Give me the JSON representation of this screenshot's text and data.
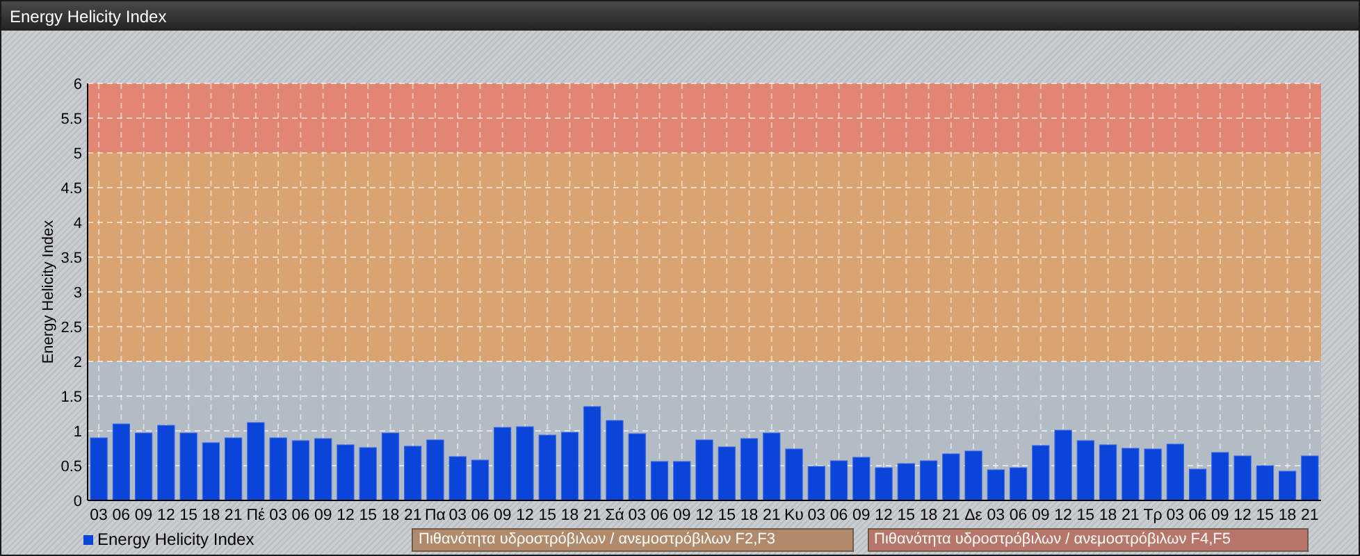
{
  "window": {
    "title": "Energy Helicity Index"
  },
  "chart": {
    "chart_data": {
      "type": "bar",
      "ylabel": "Energy Helicity Index",
      "categories": [
        "03",
        "06",
        "09",
        "12",
        "15",
        "18",
        "21",
        "Πέ",
        "03",
        "06",
        "09",
        "12",
        "15",
        "18",
        "21",
        "Πα",
        "03",
        "06",
        "09",
        "12",
        "15",
        "18",
        "21",
        "Σά",
        "03",
        "06",
        "09",
        "12",
        "15",
        "18",
        "21",
        "Κυ",
        "03",
        "06",
        "09",
        "12",
        "15",
        "18",
        "21",
        "Δε",
        "03",
        "06",
        "09",
        "12",
        "15",
        "18",
        "21",
        "Τρ",
        "03",
        "06",
        "09",
        "12",
        "15",
        "18",
        "21"
      ],
      "series": [
        {
          "name": "Energy Helicity Index",
          "color": "#0a44d8",
          "values": [
            0.9,
            1.1,
            0.97,
            1.08,
            0.97,
            0.83,
            0.9,
            1.12,
            0.9,
            0.86,
            0.89,
            0.8,
            0.76,
            0.97,
            0.78,
            0.87,
            0.63,
            0.58,
            1.05,
            1.06,
            0.94,
            0.98,
            1.35,
            1.15,
            0.96,
            0.56,
            0.56,
            0.87,
            0.77,
            0.89,
            0.97,
            0.74,
            0.49,
            0.57,
            0.62,
            0.47,
            0.53,
            0.57,
            0.67,
            0.71,
            0.44,
            0.47,
            0.79,
            1.01,
            0.86,
            0.8,
            0.75,
            0.74,
            0.81,
            0.45,
            0.69,
            0.64,
            0.5,
            0.42,
            0.64
          ]
        }
      ],
      "ylim": [
        0,
        6
      ],
      "yticks": [
        0,
        {
          "value": 0.5,
          "label": "0.5"
        },
        1,
        {
          "value": 1.5,
          "label": "1.5"
        },
        2,
        {
          "value": 2.5,
          "label": "2.5"
        },
        3,
        {
          "value": 3.5,
          "label": "3.5"
        },
        4,
        {
          "value": 4.5,
          "label": "4.5"
        },
        5,
        {
          "value": 5.5,
          "label": "5.5"
        },
        6
      ],
      "grid": true,
      "bands": [
        {
          "axis": "y",
          "from": 0,
          "to": 2,
          "color": "#b3bbc5"
        },
        {
          "axis": "y",
          "from": 2,
          "to": 5,
          "color": "#d9a472"
        },
        {
          "axis": "y",
          "from": 5,
          "to": 6,
          "color": "#e08672"
        }
      ]
    },
    "band_legend": [
      {
        "label": "Πιθανότητα υδροστρόβιλων / ανεμοστρόβιλων F2,F3",
        "color": "#b08a6a"
      },
      {
        "label": "Πιθανότητα υδροστρόβιλων / ανεμοστρόβιλων F4,F5",
        "color": "#b8766a"
      }
    ]
  }
}
